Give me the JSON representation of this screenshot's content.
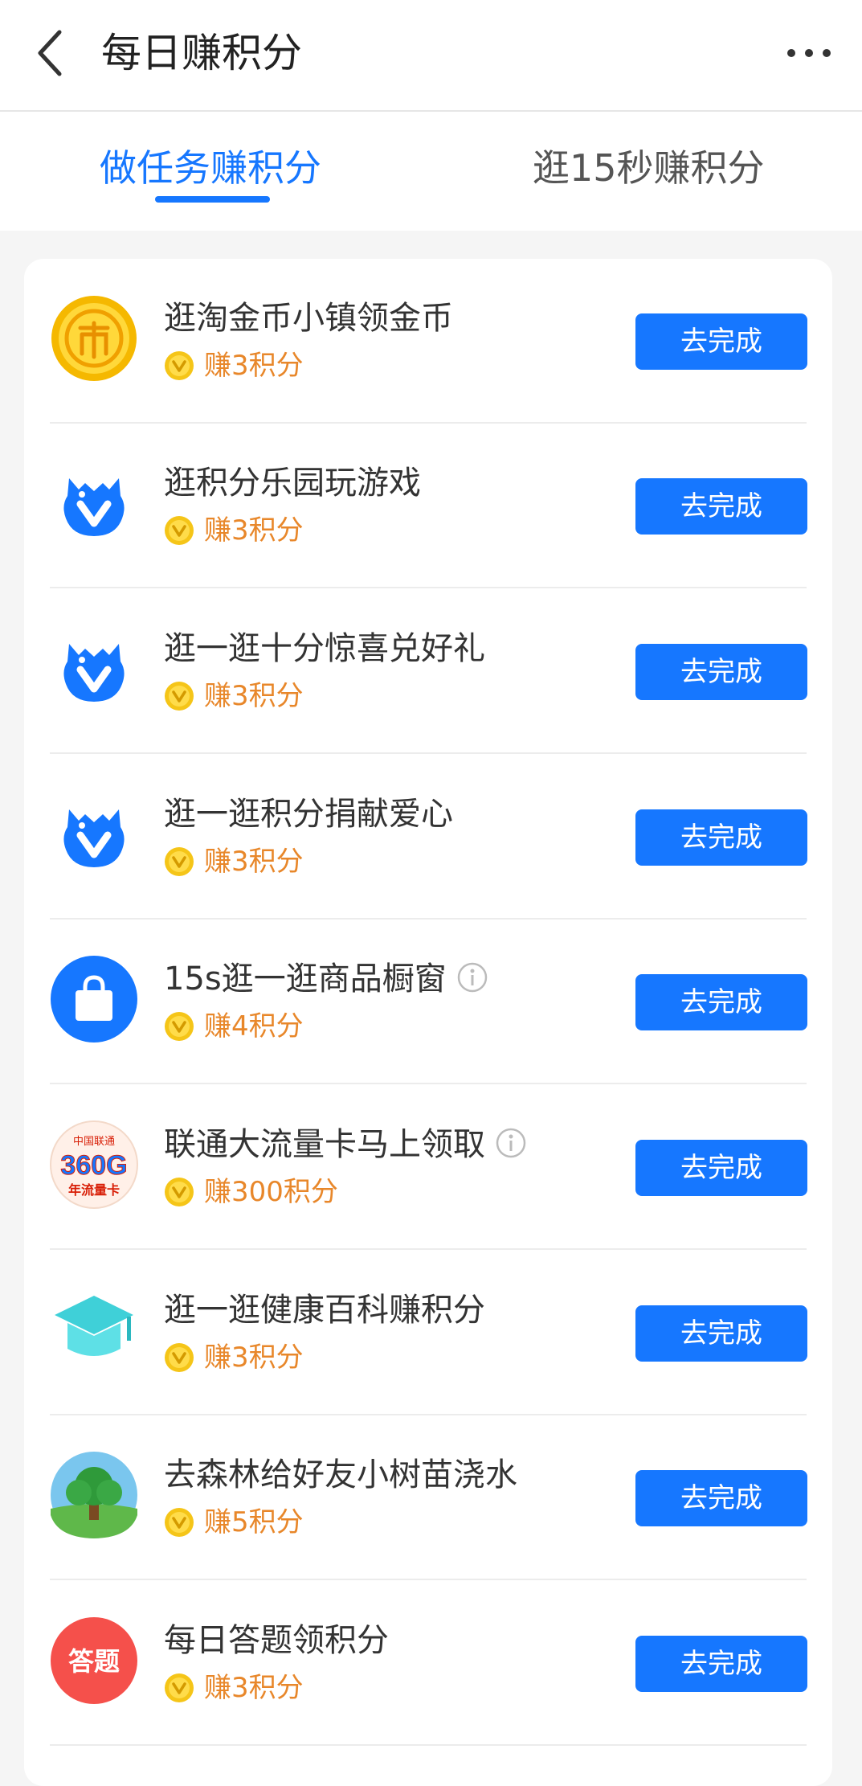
{
  "header": {
    "title": "每日赚积分"
  },
  "tabs": [
    {
      "label": "做任务赚积分",
      "active": true
    },
    {
      "label": "逛15秒赚积分",
      "active": false
    }
  ],
  "tasks": [
    {
      "title": "逛淘金币小镇领金币",
      "reward": "赚3积分",
      "button": "去完成",
      "icon": "gold-coin-icon",
      "info": false
    },
    {
      "title": "逛积分乐园玩游戏",
      "reward": "赚3积分",
      "button": "去完成",
      "icon": "blue-v-mascot-icon",
      "info": false
    },
    {
      "title": "逛一逛十分惊喜兑好礼",
      "reward": "赚3积分",
      "button": "去完成",
      "icon": "blue-v-mascot-icon",
      "info": false
    },
    {
      "title": "逛一逛积分捐献爱心",
      "reward": "赚3积分",
      "button": "去完成",
      "icon": "blue-v-mascot-icon",
      "info": false
    },
    {
      "title": "15s逛一逛商品橱窗",
      "reward": "赚4积分",
      "button": "去完成",
      "icon": "shopping-bag-icon",
      "info": true
    },
    {
      "title": "联通大流量卡马上领取",
      "reward": "赚300积分",
      "button": "去完成",
      "icon": "unicom-360g-icon",
      "info": true,
      "icon_text": [
        "中国联通",
        "360G",
        "年流量卡"
      ]
    },
    {
      "title": "逛一逛健康百科赚积分",
      "reward": "赚3积分",
      "button": "去完成",
      "icon": "graduation-cap-icon",
      "info": false
    },
    {
      "title": "去森林给好友小树苗浇水",
      "reward": "赚5积分",
      "button": "去完成",
      "icon": "tree-icon",
      "info": false
    },
    {
      "title": "每日答题领积分",
      "reward": "赚3积分",
      "button": "去完成",
      "icon": "quiz-icon",
      "info": false,
      "icon_text": [
        "答题"
      ]
    }
  ],
  "colors": {
    "accent": "#1677ff",
    "reward": "#e8872a",
    "coin": "#f5c518"
  }
}
